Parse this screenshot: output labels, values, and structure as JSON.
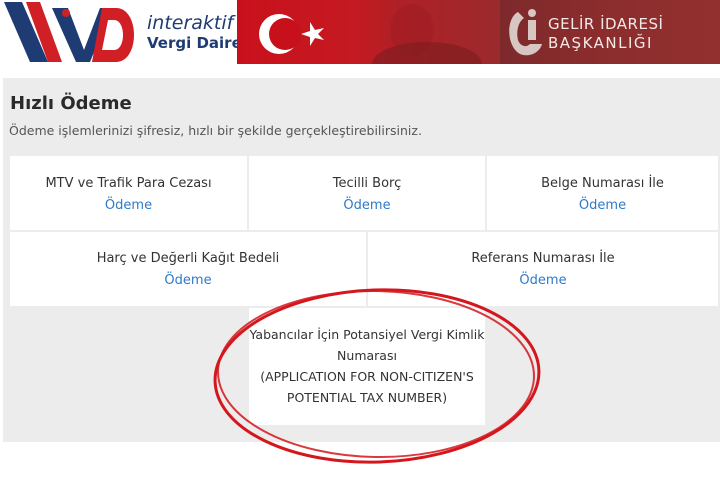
{
  "header": {
    "logo_letters": "IVD",
    "logo_line1": "interaktif",
    "logo_line2": "Vergi Dairesi",
    "gib_line1": "GELİR İDARESİ",
    "gib_line2": "BAŞKANLIĞI",
    "colors": {
      "navy": "#1f3b73",
      "red": "#d11f26",
      "flag_red": "#c8101b",
      "gib_red": "#8a2c2d"
    }
  },
  "page": {
    "title": "Hızlı Ödeme",
    "subtitle": "Ödeme işlemlerinizi şifresiz, hızlı bir şekilde gerçekleştirebilirsiniz."
  },
  "cards": [
    {
      "title": "MTV ve Trafik Para Cezası",
      "link": "Ödeme"
    },
    {
      "title": "Tecilli Borç",
      "link": "Ödeme"
    },
    {
      "title": "Belge Numarası İle",
      "link": "Ödeme"
    },
    {
      "title": "Harç ve Değerli Kağıt Bedeli",
      "link": "Ödeme"
    },
    {
      "title": "Referans Numarası İle",
      "link": "Ödeme"
    }
  ],
  "foreigner_card": {
    "line1": "Yabancılar İçin Potansiyel Vergi Kimlik",
    "line2": "Numarası",
    "line3": "(APPLICATION FOR NON-CITIZEN'S",
    "line4": "POTENTIAL TAX NUMBER)"
  },
  "colors": {
    "panel_bg": "#ececec",
    "link": "#2e7ac9",
    "annotation_red": "#d4171d"
  }
}
